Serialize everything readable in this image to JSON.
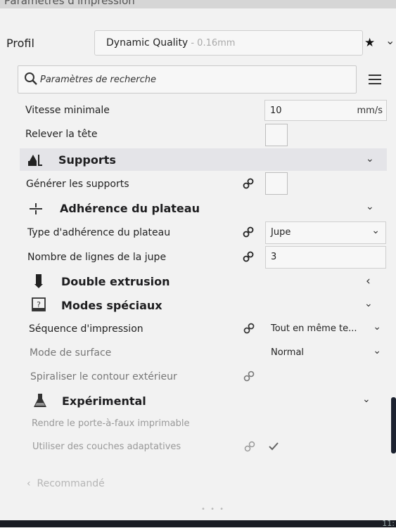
{
  "window": {
    "title": "Paramètres d'impression"
  },
  "profile": {
    "label": "Profil",
    "name": "Dynamic Quality",
    "layer": " - 0.16mm"
  },
  "search": {
    "placeholder": "Paramètres de recherche"
  },
  "settings": {
    "min_speed": {
      "label": "Vitesse minimale",
      "value": "10",
      "unit": "mm/s"
    },
    "lift_head": {
      "label": "Relever la tête"
    },
    "supports": {
      "title": "Supports"
    },
    "generate_supports": {
      "label": "Générer les supports"
    },
    "adhesion": {
      "title": "Adhérence du plateau"
    },
    "adhesion_type": {
      "label": "Type d'adhérence du plateau",
      "value": "Jupe"
    },
    "skirt_lines": {
      "label": "Nombre de lignes de la jupe",
      "value": "3"
    },
    "dual": {
      "title": "Double extrusion"
    },
    "special": {
      "title": "Modes spéciaux"
    },
    "print_sequence": {
      "label": "Séquence d'impression",
      "value": "Tout en même te..."
    },
    "surface_mode": {
      "label": "Mode de surface",
      "value": "Normal"
    },
    "spiralize": {
      "label": "Spiraliser le contour extérieur"
    },
    "experimental": {
      "title": "Expérimental"
    },
    "overhang": {
      "label": "Rendre le porte-à-faux imprimable"
    },
    "adaptive_layers": {
      "label": "Utiliser des couches adaptatives"
    }
  },
  "footer": {
    "recommended": "Recommandé",
    "clock": "11:"
  },
  "icons": {
    "search": "magnifier-icon",
    "menu": "hamburger-icon",
    "star": "star-icon",
    "link": "link-icon",
    "chevron_down": "chevron-down-icon",
    "chevron_left": "chevron-left-icon"
  }
}
